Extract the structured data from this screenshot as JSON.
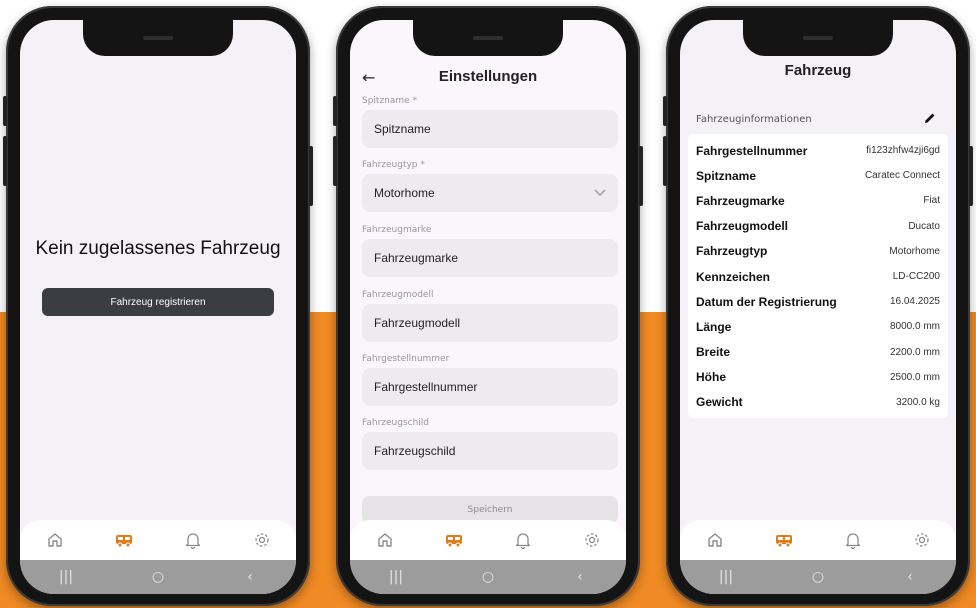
{
  "colors": {
    "accent": "#f08a24",
    "tab_active": "#e07b17",
    "tab_inactive": "#8a8a8a"
  },
  "tabbar_icons": [
    "home-icon",
    "vehicle-icon",
    "bell-icon",
    "settings-icon"
  ],
  "sysnav": {
    "recent": "|||",
    "home": "○",
    "back": "‹"
  },
  "screen1": {
    "message": "Kein zugelassenes Fahrzeug",
    "register_button": "Fahrzeug registrieren"
  },
  "screen2": {
    "back": "←",
    "title": "Einstellungen",
    "fields": [
      {
        "label": "Spitzname *",
        "value": "Spitzname"
      },
      {
        "label": "Fahrzeugtyp *",
        "value": "Motorhome"
      },
      {
        "label": "Fahrzeugmarke",
        "value": "Fahrzeugmarke"
      },
      {
        "label": "Fahrzeugmodell",
        "value": "Fahrzeugmodell"
      },
      {
        "label": "Fahrgestellnummer",
        "value": "Fahrgestellnummer"
      },
      {
        "label": "Fahrzeugschild",
        "value": "Fahrzeugschild"
      }
    ],
    "save_button": "Speichern"
  },
  "screen3": {
    "title": "Fahrzeug",
    "section": "Fahrzeuginformationen",
    "rows": [
      {
        "key": "Fahrgestellnummer",
        "value": "fi123zhfw4zji6gd"
      },
      {
        "key": "Spitzname",
        "value": "Caratec Connect"
      },
      {
        "key": "Fahrzeugmarke",
        "value": "Fiat"
      },
      {
        "key": "Fahrzeugmodell",
        "value": "Ducato"
      },
      {
        "key": "Fahrzeugtyp",
        "value": "Motorhome"
      },
      {
        "key": "Kennzeichen",
        "value": "LD-CC200"
      },
      {
        "key": "Datum der Registrierung",
        "value": "16.04.2025"
      },
      {
        "key": "Länge",
        "value": "8000.0 mm"
      },
      {
        "key": "Breite",
        "value": "2200.0 mm"
      },
      {
        "key": "Höhe",
        "value": "2500.0 mm"
      },
      {
        "key": "Gewicht",
        "value": "3200.0 kg"
      }
    ]
  }
}
